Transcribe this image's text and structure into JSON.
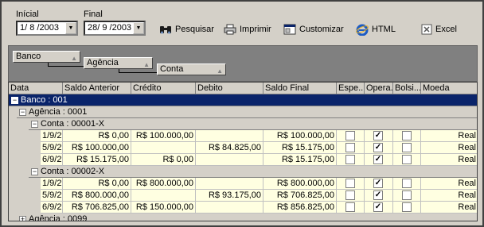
{
  "filters": {
    "start_label": "Inícial",
    "start_value": "1/ 8 /2003",
    "end_label": "Final",
    "end_value": "28/ 9 /2003"
  },
  "toolbar": {
    "search_label": "Pesquisar",
    "print_label": "Imprimir",
    "customize_label": "Customizar",
    "html_label": "HTML",
    "excel_label": "Excel"
  },
  "grouping": {
    "levels": [
      "Banco",
      "Agência",
      "Conta"
    ]
  },
  "grid": {
    "columns": [
      "Data",
      "Saldo Anterior",
      "Crédito",
      "Debito",
      "Saldo Final",
      "Espe...",
      "Opera...",
      "Bolsi...",
      "Moeda"
    ],
    "bank_group": "Banco : 001",
    "agency_group_1": "Agência : 0001",
    "agency_group_2": "Agência : 0099",
    "accounts": [
      {
        "label": "Conta : 00001-X",
        "rows": [
          {
            "data": "1/9/2",
            "saldo_anterior": "R$ 0,00",
            "credito": "R$ 100.000,00",
            "debito": "",
            "saldo_final": "R$ 100.000,00",
            "espe": false,
            "opera": true,
            "bolsi": false,
            "moeda": "Real"
          },
          {
            "data": "5/9/2",
            "saldo_anterior": "R$ 100.000,00",
            "credito": "",
            "debito": "R$ 84.825,00",
            "saldo_final": "R$ 15.175,00",
            "espe": false,
            "opera": true,
            "bolsi": false,
            "moeda": "Real"
          },
          {
            "data": "6/9/2",
            "saldo_anterior": "R$ 15.175,00",
            "credito": "R$ 0,00",
            "debito": "",
            "saldo_final": "R$ 15.175,00",
            "espe": false,
            "opera": true,
            "bolsi": false,
            "moeda": "Real"
          }
        ]
      },
      {
        "label": "Conta : 00002-X",
        "rows": [
          {
            "data": "1/9/2",
            "saldo_anterior": "R$ 0,00",
            "credito": "R$ 800.000,00",
            "debito": "",
            "saldo_final": "R$ 800.000,00",
            "espe": false,
            "opera": true,
            "bolsi": false,
            "moeda": "Real"
          },
          {
            "data": "5/9/2",
            "saldo_anterior": "R$ 800.000,00",
            "credito": "",
            "debito": "R$ 93.175,00",
            "saldo_final": "R$ 706.825,00",
            "espe": false,
            "opera": true,
            "bolsi": false,
            "moeda": "Real"
          },
          {
            "data": "6/9/2",
            "saldo_anterior": "R$ 706.825,00",
            "credito": "R$ 150.000,00",
            "debito": "",
            "saldo_final": "R$ 856.825,00",
            "espe": false,
            "opera": true,
            "bolsi": false,
            "moeda": "Real"
          }
        ]
      }
    ]
  },
  "colors": {
    "selection": "#0a246a",
    "data_row_bg": "#ffffe1",
    "panel_gray": "#808080"
  }
}
